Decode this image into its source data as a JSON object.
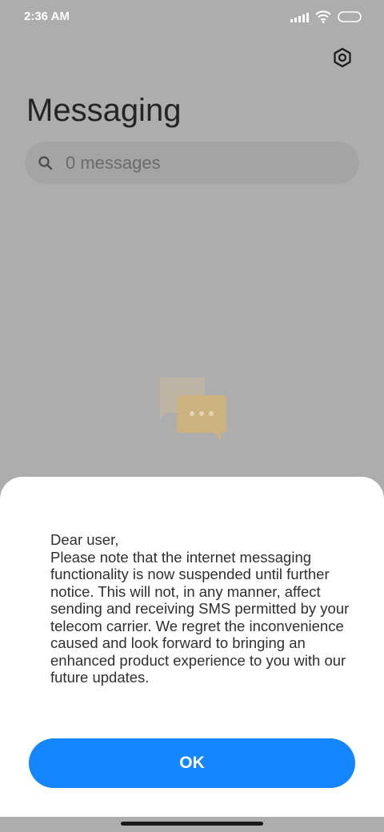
{
  "status_bar": {
    "time": "2:36 AM"
  },
  "header": {
    "title": "Messaging",
    "settings_icon": "gear-icon"
  },
  "search": {
    "placeholder": "0 messages",
    "icon": "search-icon"
  },
  "empty_state": {
    "icon": "chat-bubbles-icon"
  },
  "dialog": {
    "greeting": "Dear user,",
    "message": "Please note that the internet messaging functionality is now suspended until further notice. This will not, in any manner, affect sending and receiving SMS permitted by your telecom carrier. We regret the inconvenience caused and look forward to bringing an enhanced product experience to you with our future updates.",
    "ok_label": "OK"
  },
  "colors": {
    "accent": "#1486ff",
    "dim_background": "#adadad",
    "sheet": "#ffffff"
  }
}
